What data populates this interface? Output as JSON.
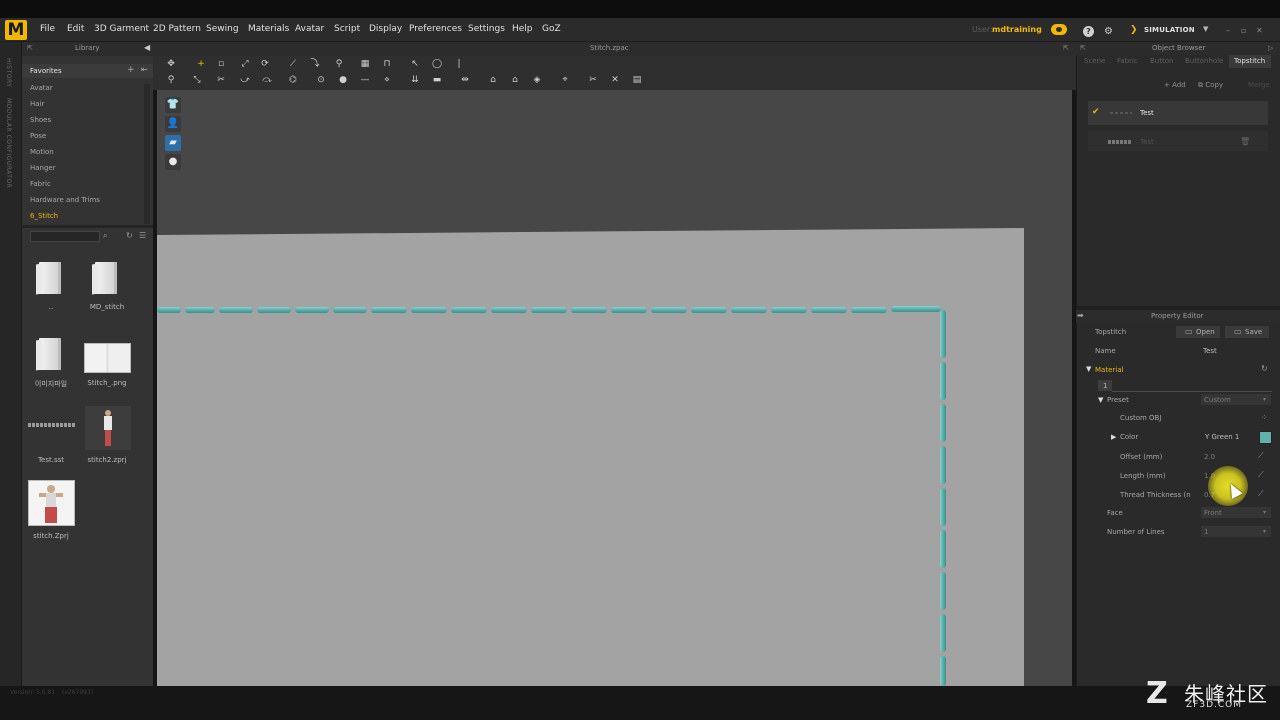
{
  "app": {
    "logo_letter": "M",
    "menus": [
      "File",
      "Edit",
      "3D Garment",
      "2D Pattern",
      "Sewing",
      "Materials",
      "Avatar",
      "Script",
      "Display",
      "Preferences",
      "Settings",
      "Help",
      "GoZ"
    ],
    "user_prefix": "User:",
    "user": "mdtraining",
    "mode": "SIMULATION"
  },
  "left_strip": {
    "items": [
      "HISTORY",
      "MODULAR CONFIGURATOR"
    ]
  },
  "library": {
    "title": "Library",
    "favorites_label": "Favorites",
    "tree": [
      "Avatar",
      "Hair",
      "Shoes",
      "Pose",
      "Motion",
      "Hanger",
      "Fabric",
      "Hardware and Trims",
      "6_Stitch"
    ],
    "active_item": "6_Stitch",
    "files": [
      {
        "label": "..",
        "type": "folder"
      },
      {
        "label": "MD_stitch",
        "type": "folder"
      },
      {
        "label": "이미지파일",
        "type": "folder"
      },
      {
        "label": "Stitch_.png",
        "type": "image"
      },
      {
        "label": "Test.sst",
        "type": "stitch"
      },
      {
        "label": "stitch2.zprj",
        "type": "project"
      },
      {
        "label": "stitch.Zprj",
        "type": "project"
      }
    ]
  },
  "viewport": {
    "title": "Stitch.zpac"
  },
  "object_browser": {
    "title": "Object Browser",
    "tabs": [
      "Scene",
      "Fabric",
      "Button",
      "Buttonhole",
      "Topstitch"
    ],
    "active_tab": "Topstitch",
    "add_label": "Add",
    "copy_label": "Copy",
    "merge_label": "Merge",
    "items": [
      {
        "name": "Test",
        "selected": true
      },
      {
        "name": "Test",
        "selected": false
      }
    ]
  },
  "property_editor": {
    "title": "Property Editor",
    "type_label": "Topstitch",
    "open_label": "Open",
    "save_label": "Save",
    "name_label": "Name",
    "name_value": "Test",
    "material_label": "Material",
    "index_value": "1",
    "preset_label": "Preset",
    "preset_value": "Custom",
    "custom_obj_label": "Custom OBJ",
    "color_label": "Color",
    "color_value": "Y Green 1",
    "color_hex": "#5fb3ab",
    "offset_label": "Offset (mm)",
    "offset_value": "2.0",
    "length_label": "Length (mm)",
    "length_value": "1.0",
    "thickness_label": "Thread Thickness (n",
    "thickness_value": "0.7",
    "face_label": "Face",
    "face_value": "Front",
    "lines_label": "Number of Lines",
    "lines_value": "1"
  },
  "status": {
    "left": "Version: 5.0.81",
    "right": "(x267993)"
  },
  "watermark": {
    "logo": "Z",
    "cn": "朱峰社区",
    "url": "ZF3D.COM"
  },
  "colors": {
    "accent": "#f2b800",
    "stitch": "#5fb3ab",
    "fabric": "#a3a3a3",
    "viewport_bg": "#474747"
  }
}
